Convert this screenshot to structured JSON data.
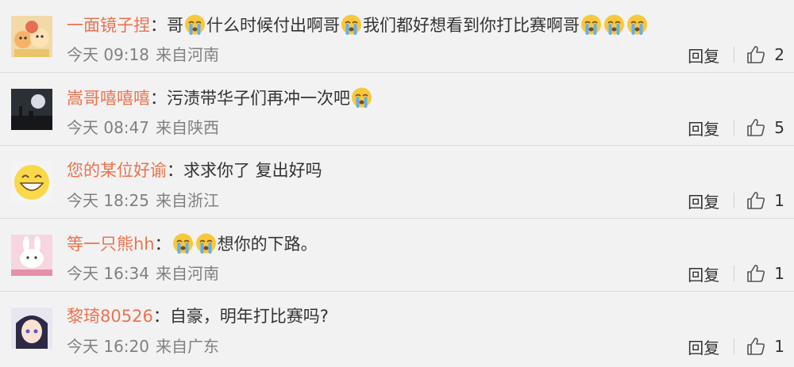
{
  "comments": [
    {
      "username": "一面镜子捏",
      "separator": "：",
      "segments": [
        "哥",
        "[cry]",
        "什么时候付出啊哥",
        "[cry]",
        "我们都好想看到你打比赛啊哥",
        "[cry]",
        "[cry]",
        "[cry]"
      ],
      "time": "今天 09:18",
      "location": "来自河南",
      "reply_label": "回复",
      "likes": "2",
      "avatar": "cartoon-group-avatar"
    },
    {
      "username": "嵩哥嘻嘻嘻",
      "separator": "：",
      "segments": [
        "污渍带华子们再冲一次吧",
        "[cry]"
      ],
      "time": "今天 08:47",
      "location": "来自陕西",
      "reply_label": "回复",
      "likes": "5",
      "avatar": "dark-night-avatar"
    },
    {
      "username": "您的某位好谕",
      "separator": "：",
      "segments": [
        "求求你了 复出好吗"
      ],
      "time": "今天 18:25",
      "location": "来自浙江",
      "reply_label": "回复",
      "likes": "1",
      "avatar": "smiley-avatar"
    },
    {
      "username": "等一只熊hh",
      "separator": "：",
      "segments": [
        "[cry]",
        "[cry]",
        "想你的下路。"
      ],
      "time": "今天 16:34",
      "location": "来自河南",
      "reply_label": "回复",
      "likes": "1",
      "avatar": "pink-bunny-avatar"
    },
    {
      "username": "黎琦80526",
      "separator": "：",
      "segments": [
        "自豪，明年打比赛吗?"
      ],
      "time": "今天 16:20",
      "location": "来自广东",
      "reply_label": "回复",
      "likes": "1",
      "avatar": "anime-girl-avatar"
    }
  ],
  "colors": {
    "username": "#eb7350",
    "meta": "#808080",
    "background": "#f2f2f2",
    "divider": "#dcdcdc"
  }
}
